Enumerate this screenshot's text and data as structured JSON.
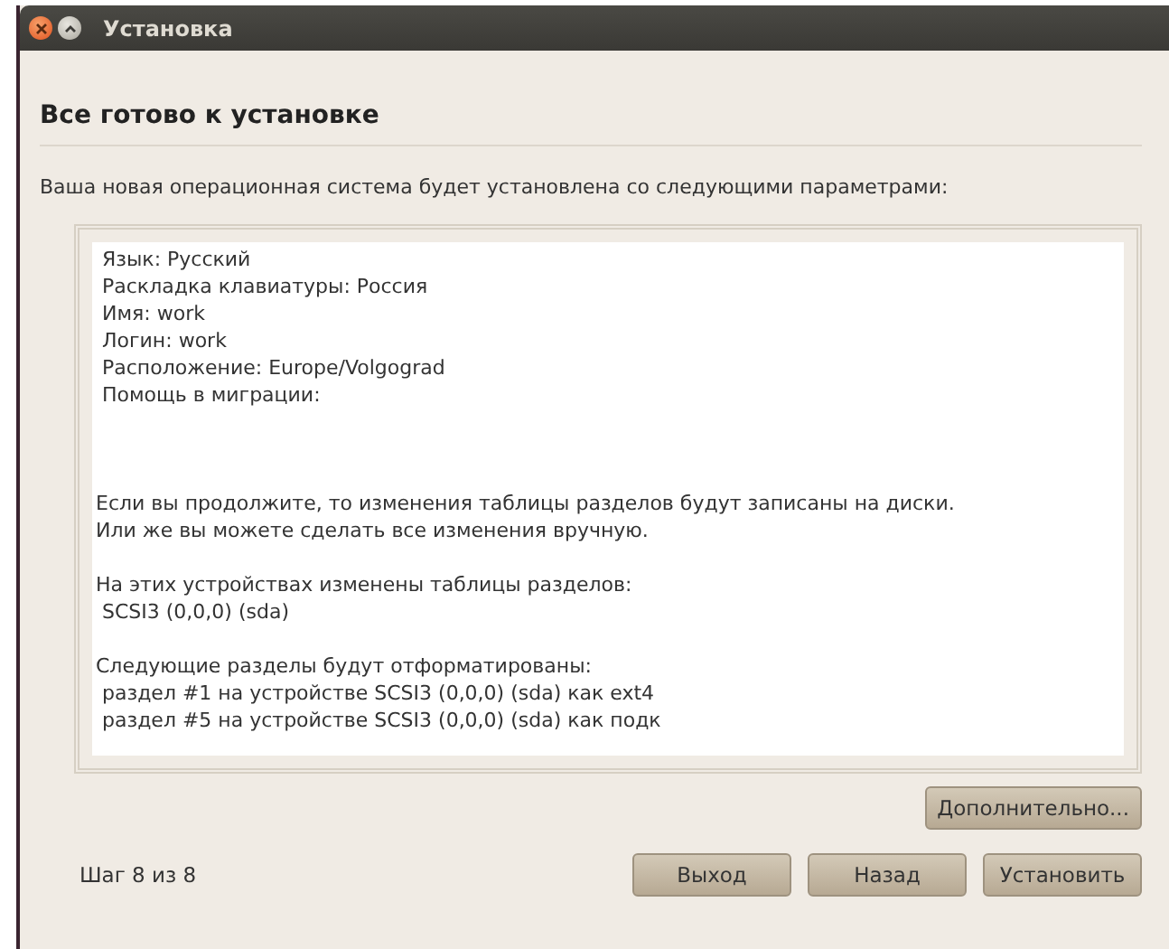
{
  "window": {
    "title": "Установка"
  },
  "heading": "Все готово к установке",
  "intro": "Ваша новая операционная система будет установлена со следующими параметрами:",
  "summary": [
    {
      "lines": [
        " Язык: Русский",
        " Раскладка клавиатуры: Россия",
        " Имя: work",
        " Логин: work",
        " Расположение: Europe/Volgograd",
        " Помощь в миграции:"
      ]
    },
    {
      "lines": [
        "Если вы продолжите, то изменения таблицы разделов будут записаны на диски.",
        "Или же вы можете сделать все изменения вручную."
      ]
    },
    {
      "lines": [
        "На этих устройствах изменены таблицы разделов:",
        " SCSI3 (0,0,0) (sda)"
      ]
    },
    {
      "lines": [
        "Следующие разделы будут отформатированы:",
        " раздел #1 на устройстве SCSI3 (0,0,0) (sda) как ext4",
        " раздел #5 на устройстве SCSI3 (0,0,0) (sda) как подк"
      ]
    }
  ],
  "advanced_button": "Дополнительно...",
  "step": "Шаг 8 из 8",
  "buttons": [
    "Выход",
    "Назад",
    "Установить"
  ]
}
